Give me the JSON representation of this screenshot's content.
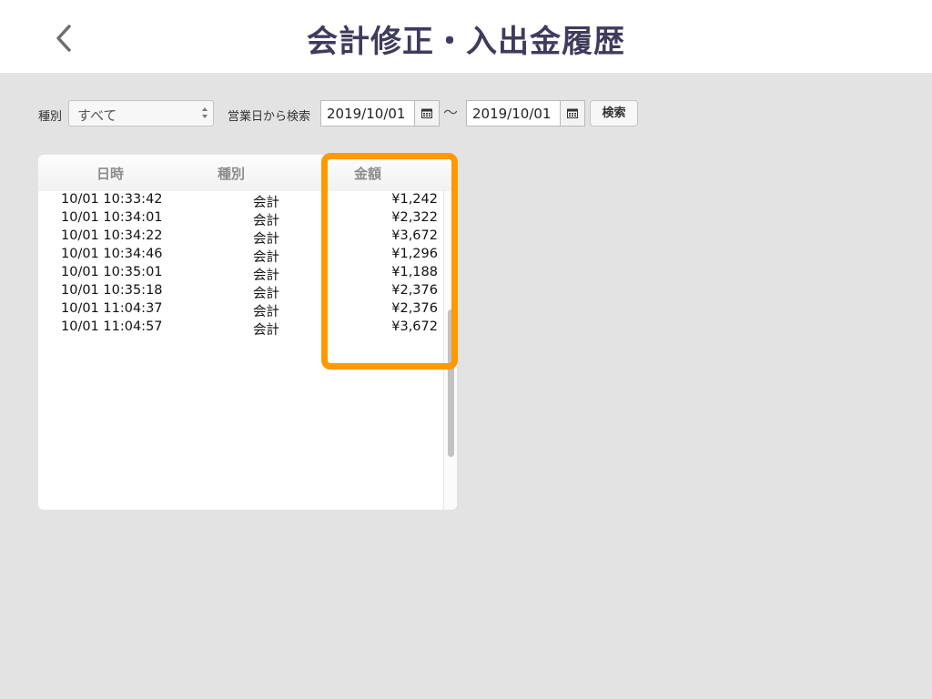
{
  "header": {
    "title": "会計修正・入出金履歴",
    "back_icon": "chevron-left-icon"
  },
  "filters": {
    "type_label": "種別",
    "type_selected": "すべて",
    "date_search_label": "営業日から検索",
    "date_from": "2019/10/01",
    "range_separator": "〜",
    "date_to": "2019/10/01",
    "calendar_icon": "calendar-icon",
    "search_label": "検索"
  },
  "table": {
    "headers": {
      "datetime": "日時",
      "type": "種別",
      "amount": "金額"
    },
    "rows": [
      {
        "datetime": "10/01 10:33:42",
        "type": "会計",
        "amount": "¥1,242"
      },
      {
        "datetime": "10/01 10:34:01",
        "type": "会計",
        "amount": "¥2,322"
      },
      {
        "datetime": "10/01 10:34:22",
        "type": "会計",
        "amount": "¥3,672"
      },
      {
        "datetime": "10/01 10:34:46",
        "type": "会計",
        "amount": "¥1,296"
      },
      {
        "datetime": "10/01 10:35:01",
        "type": "会計",
        "amount": "¥1,188"
      },
      {
        "datetime": "10/01 10:35:18",
        "type": "会計",
        "amount": "¥2,376"
      },
      {
        "datetime": "10/01 11:04:37",
        "type": "会計",
        "amount": "¥2,376"
      },
      {
        "datetime": "10/01 11:04:57",
        "type": "会計",
        "amount": "¥3,672"
      }
    ]
  },
  "colors": {
    "title": "#3f3b5c",
    "highlight": "#ff9900",
    "background": "#e3e3e3"
  }
}
